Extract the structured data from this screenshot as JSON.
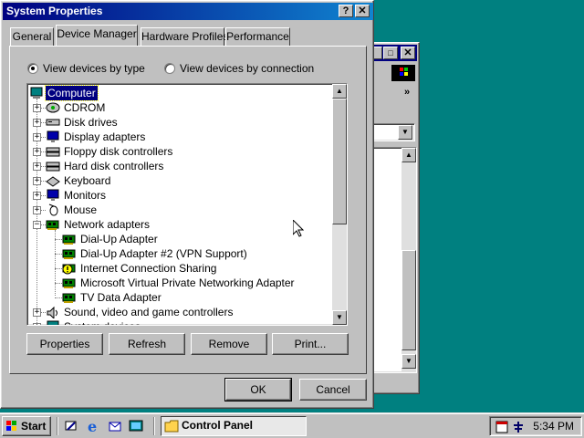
{
  "dialog": {
    "title": "System Properties",
    "help_glyph": "?",
    "close_glyph": "✕",
    "tabs": [
      {
        "label": "General"
      },
      {
        "label": "Device Manager"
      },
      {
        "label": "Hardware Profiles"
      },
      {
        "label": "Performance"
      }
    ],
    "view_by_type": "View devices by type",
    "view_by_connection": "View devices by connection",
    "tree": [
      {
        "label": "Computer",
        "icon": "computer-icon",
        "level": 0,
        "expander": "",
        "selected": true
      },
      {
        "label": "CDROM",
        "icon": "cdrom-icon",
        "level": 1,
        "expander": "+"
      },
      {
        "label": "Disk drives",
        "icon": "disk-drive-icon",
        "level": 1,
        "expander": "+"
      },
      {
        "label": "Display adapters",
        "icon": "monitor-icon",
        "level": 1,
        "expander": "+"
      },
      {
        "label": "Floppy disk controllers",
        "icon": "controller-icon",
        "level": 1,
        "expander": "+"
      },
      {
        "label": "Hard disk controllers",
        "icon": "controller-icon",
        "level": 1,
        "expander": "+"
      },
      {
        "label": "Keyboard",
        "icon": "keyboard-icon",
        "level": 1,
        "expander": "+"
      },
      {
        "label": "Monitors",
        "icon": "monitor-icon",
        "level": 1,
        "expander": "+"
      },
      {
        "label": "Mouse",
        "icon": "mouse-icon",
        "level": 1,
        "expander": "+"
      },
      {
        "label": "Network adapters",
        "icon": "network-card-icon",
        "level": 1,
        "expander": "−"
      },
      {
        "label": "Dial-Up Adapter",
        "icon": "network-card-icon",
        "level": 2,
        "expander": ""
      },
      {
        "label": "Dial-Up Adapter #2 (VPN Support)",
        "icon": "network-card-icon",
        "level": 2,
        "expander": ""
      },
      {
        "label": "Internet Connection Sharing",
        "icon": "warning-network-icon",
        "level": 2,
        "expander": ""
      },
      {
        "label": "Microsoft Virtual Private Networking Adapter",
        "icon": "network-card-icon",
        "level": 2,
        "expander": ""
      },
      {
        "label": "TV Data Adapter",
        "icon": "network-card-icon",
        "level": 2,
        "expander": ""
      },
      {
        "label": "Sound, video and game controllers",
        "icon": "sound-icon",
        "level": 1,
        "expander": "+"
      },
      {
        "label": "System devices",
        "icon": "computer-icon",
        "level": 1,
        "expander": "+"
      }
    ],
    "buttons": {
      "properties": "Properties",
      "refresh": "Refresh",
      "remove": "Remove",
      "print": "Print...",
      "ok": "OK",
      "cancel": "Cancel"
    }
  },
  "background_window": {
    "chevron": "»"
  },
  "taskbar": {
    "start_label": "Start",
    "task_label": "Control Panel",
    "clock": "5:34 PM"
  },
  "colors": {
    "desktop": "#008080",
    "title_bar": "#000080",
    "face": "#c0c0c0"
  }
}
